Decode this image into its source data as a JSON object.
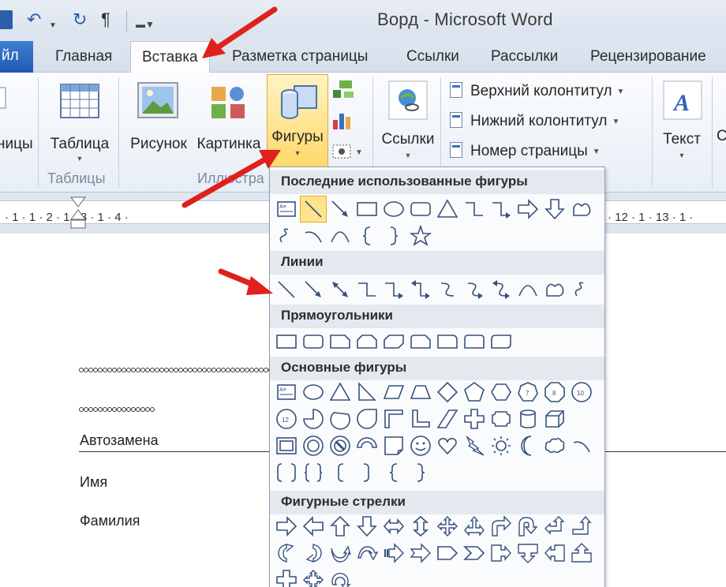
{
  "window": {
    "title": "Ворд  -  Microsoft Word"
  },
  "quick_access": {
    "undo_icon": "undo-icon",
    "redo_icon": "redo-icon",
    "pilcrow": "¶",
    "customize_icon": "customize-icon"
  },
  "tabs": {
    "file": "йл",
    "items": [
      "Главная",
      "Вставка",
      "Разметка страницы",
      "Ссылки",
      "Рассылки",
      "Рецензирование"
    ],
    "active": "Вставка"
  },
  "ribbon": {
    "pages_fragment": "ницы",
    "table": "Таблица",
    "tables_group": "Таблицы",
    "picture": "Рисунок",
    "clipart": "Картинка",
    "shapes": "Фигуры",
    "illustrations_group": "Иллюстра",
    "links": "Ссылки",
    "header": "Верхний колонтитул",
    "footer": "Нижний колонтитул",
    "page_number": "Номер страницы",
    "text": "Текст"
  },
  "ruler": {
    "ticks": "· 1 · 1 · 2 · 1 · 3 · 1 · 4 ·",
    "right_ticks": "· 12 · 1 · 13 · 1 ·"
  },
  "document": {
    "autocorrect": "Автозамена",
    "name": "Имя",
    "surname": "Фамилия"
  },
  "shapes_menu": {
    "recent": "Последние использованные фигуры",
    "lines": "Линии",
    "rectangles": "Прямоугольники",
    "basic": "Основные фигуры",
    "block_arrows": "Фигурные стрелки"
  },
  "colors": {
    "accent": "#2b579a",
    "highlight": "#ffe48c",
    "arrow": "#e0201b",
    "section_bg": "#e4e9f0"
  }
}
